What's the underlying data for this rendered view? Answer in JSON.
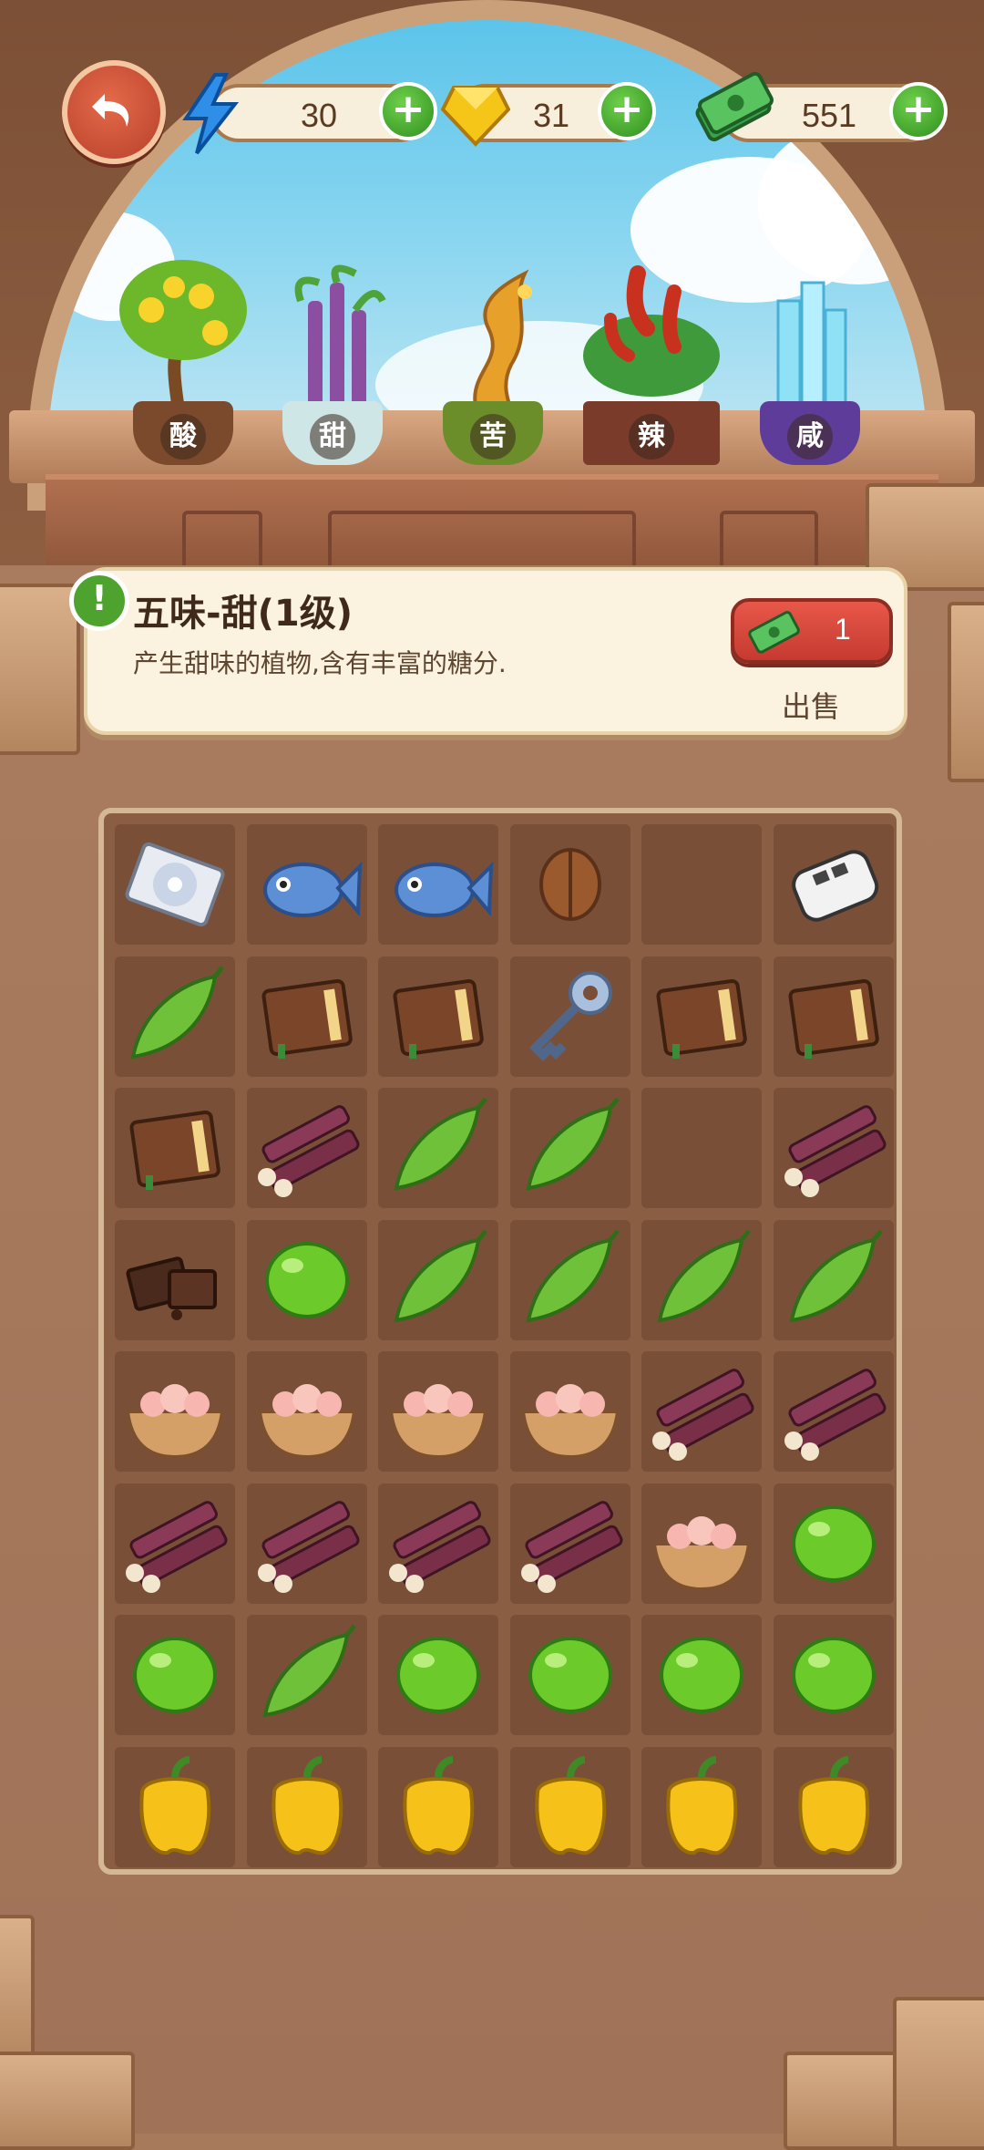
{
  "resources": {
    "energy": {
      "value": "30",
      "icon": "lightning-icon"
    },
    "gems": {
      "value": "31",
      "icon": "gem-icon"
    },
    "cash": {
      "value": "551",
      "icon": "cash-icon"
    }
  },
  "plants": [
    {
      "label": "酸",
      "kind": "lemon-tree"
    },
    {
      "label": "甜",
      "kind": "sugarcane-plant"
    },
    {
      "label": "苦",
      "kind": "golden-root"
    },
    {
      "label": "辣",
      "kind": "chili-plant"
    },
    {
      "label": "咸",
      "kind": "salt-crystal"
    }
  ],
  "info": {
    "title": "五味-甜(1级)",
    "description": "产生甜味的植物,含有丰富的糖分.",
    "sell_price": "1",
    "sell_label": "出售"
  },
  "grid": {
    "rows": [
      [
        "disc",
        "fish",
        "fish",
        "walnut",
        "empty",
        "car-key"
      ],
      [
        "bitter-melon",
        "book",
        "book",
        "key",
        "book",
        "book"
      ],
      [
        "book",
        "sugarcane",
        "bitter-melon",
        "bitter-melon",
        "empty",
        "sugarcane"
      ],
      [
        "chocolate",
        "lime",
        "bitter-melon",
        "bitter-melon",
        "bitter-melon",
        "bitter-melon"
      ],
      [
        "salt-bowl",
        "salt-bowl",
        "salt-bowl",
        "salt-bowl",
        "sugarcane",
        "sugarcane"
      ],
      [
        "sugarcane",
        "sugarcane",
        "sugarcane",
        "sugarcane",
        "salt-bowl",
        "lime"
      ],
      [
        "lime",
        "bitter-melon",
        "lime",
        "lime",
        "lime",
        "lime"
      ],
      [
        "bell-pepper",
        "bell-pepper",
        "bell-pepper",
        "bell-pepper",
        "bell-pepper",
        "bell-pepper"
      ]
    ]
  }
}
